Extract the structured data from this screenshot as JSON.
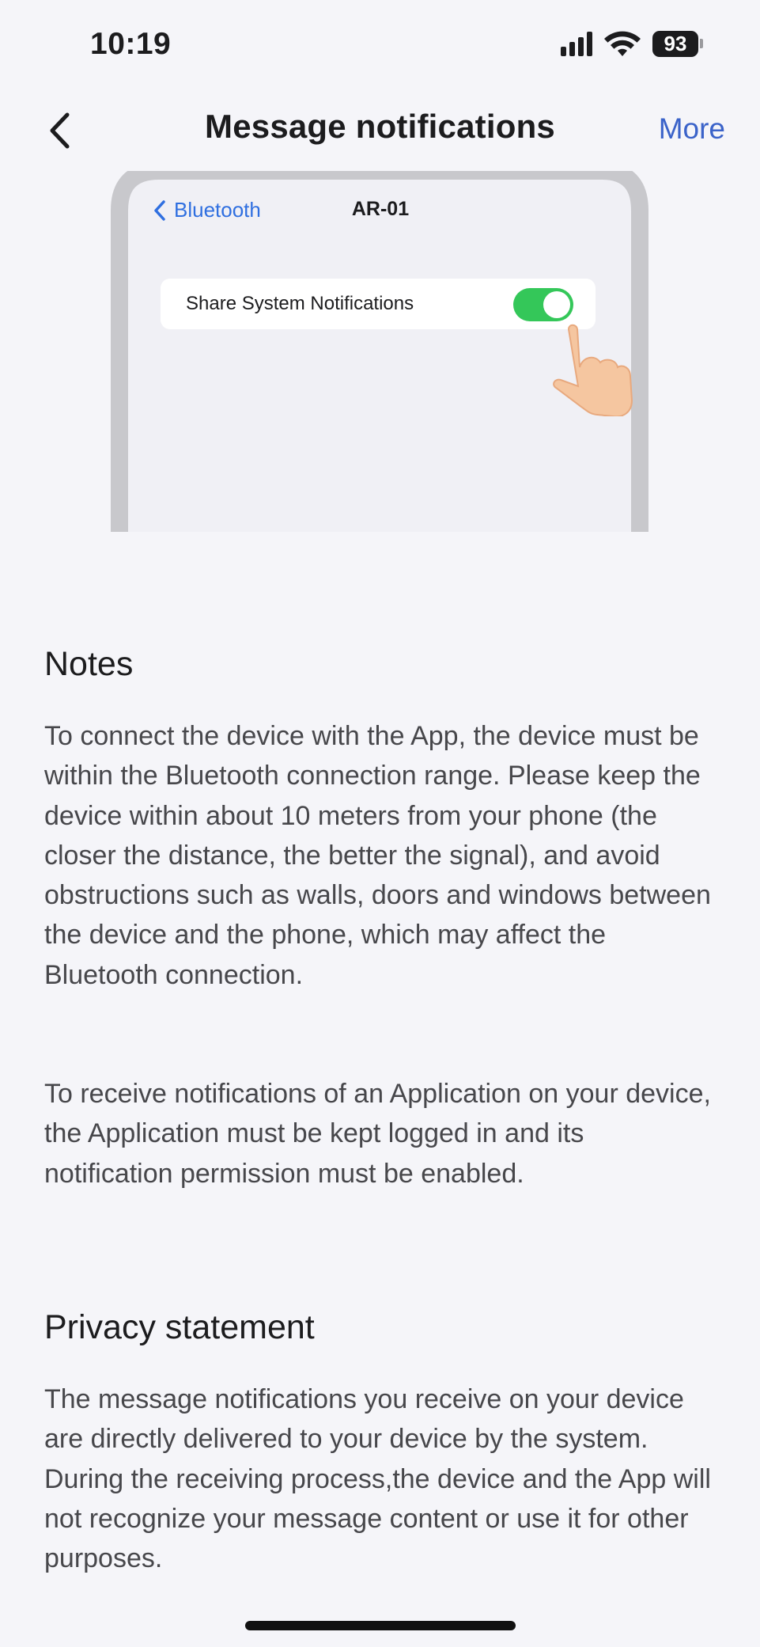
{
  "status_bar": {
    "time": "10:19",
    "battery": "93",
    "icons": [
      "signal-icon",
      "wifi-icon",
      "battery-icon"
    ]
  },
  "nav": {
    "back_icon": "chevron-left-icon",
    "title": "Message notifications",
    "more_label": "More"
  },
  "illustration": {
    "back_label": "Bluetooth",
    "device_title": "AR-01",
    "setting_label": "Share System Notifications",
    "toggle_state": "on",
    "toggle_color": "#34c759",
    "pointer_icon": "hand-pointer-icon"
  },
  "notes": {
    "heading": "Notes",
    "paragraphs": [
      "To connect the device with the App, the device must be within the Bluetooth connection range. Please keep the device within about 10 meters from your phone (the closer the distance, the better the signal), and avoid obstructions such as walls, doors and windows between the device and the phone, which may affect the Bluetooth connection.",
      "To receive notifications of an Application on your device, the Application must be kept logged in and its notification permission must be enabled."
    ]
  },
  "privacy": {
    "heading": "Privacy statement",
    "paragraph": "The message notifications you receive on your device are directly delivered to your device by the system. During the receiving process,the device and the App will not recognize your message content or use it for other purposes."
  },
  "colors": {
    "accent": "#3b63c9",
    "background": "#f5f5f9",
    "body_text": "#47474b"
  }
}
